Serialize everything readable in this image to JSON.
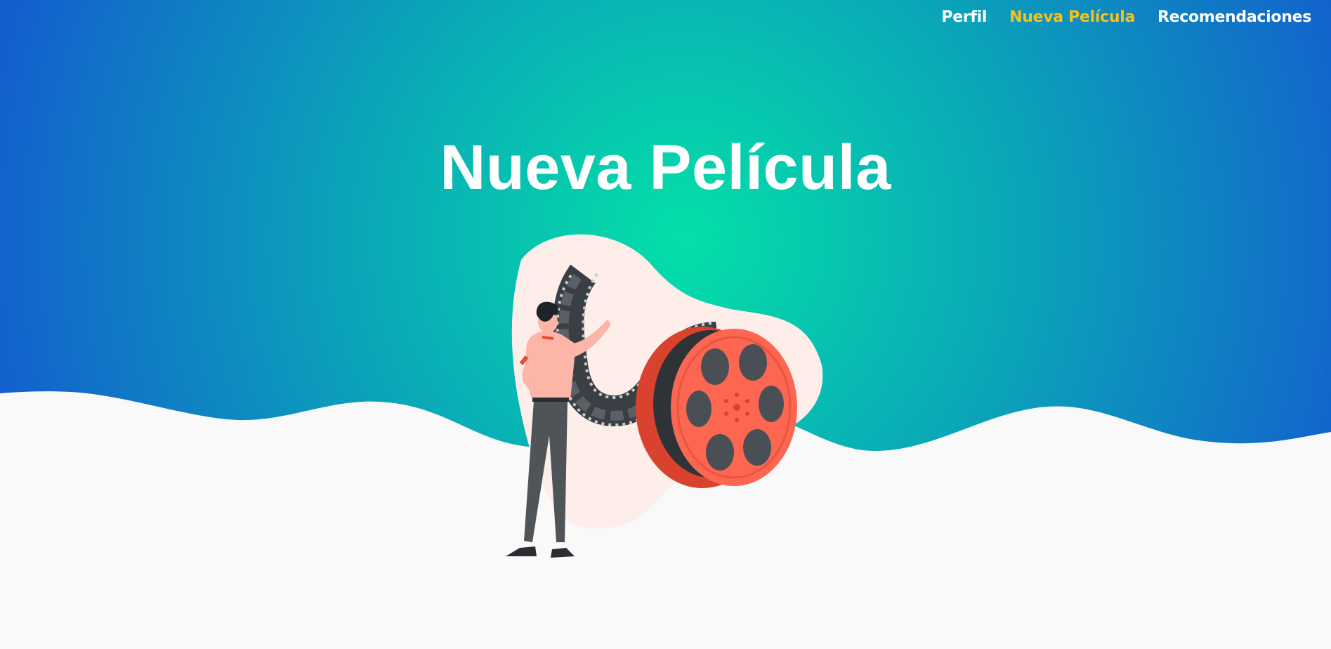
{
  "nav": {
    "items": [
      {
        "label": "Perfil",
        "active": false
      },
      {
        "label": "Nueva Película",
        "active": true
      },
      {
        "label": "Recomendaciones",
        "active": false
      }
    ]
  },
  "hero": {
    "title": "Nueva Película"
  },
  "colors": {
    "gradient_center": "#04e0a8",
    "gradient_mid": "#0aa6b8",
    "gradient_edge": "#1459cf",
    "page_background": "#f9f9f9",
    "nav_active": "#f5c21b",
    "nav_text": "#ffffff",
    "reel": "#fd6751"
  },
  "illustration": {
    "icon": "film-reel-illustration"
  }
}
